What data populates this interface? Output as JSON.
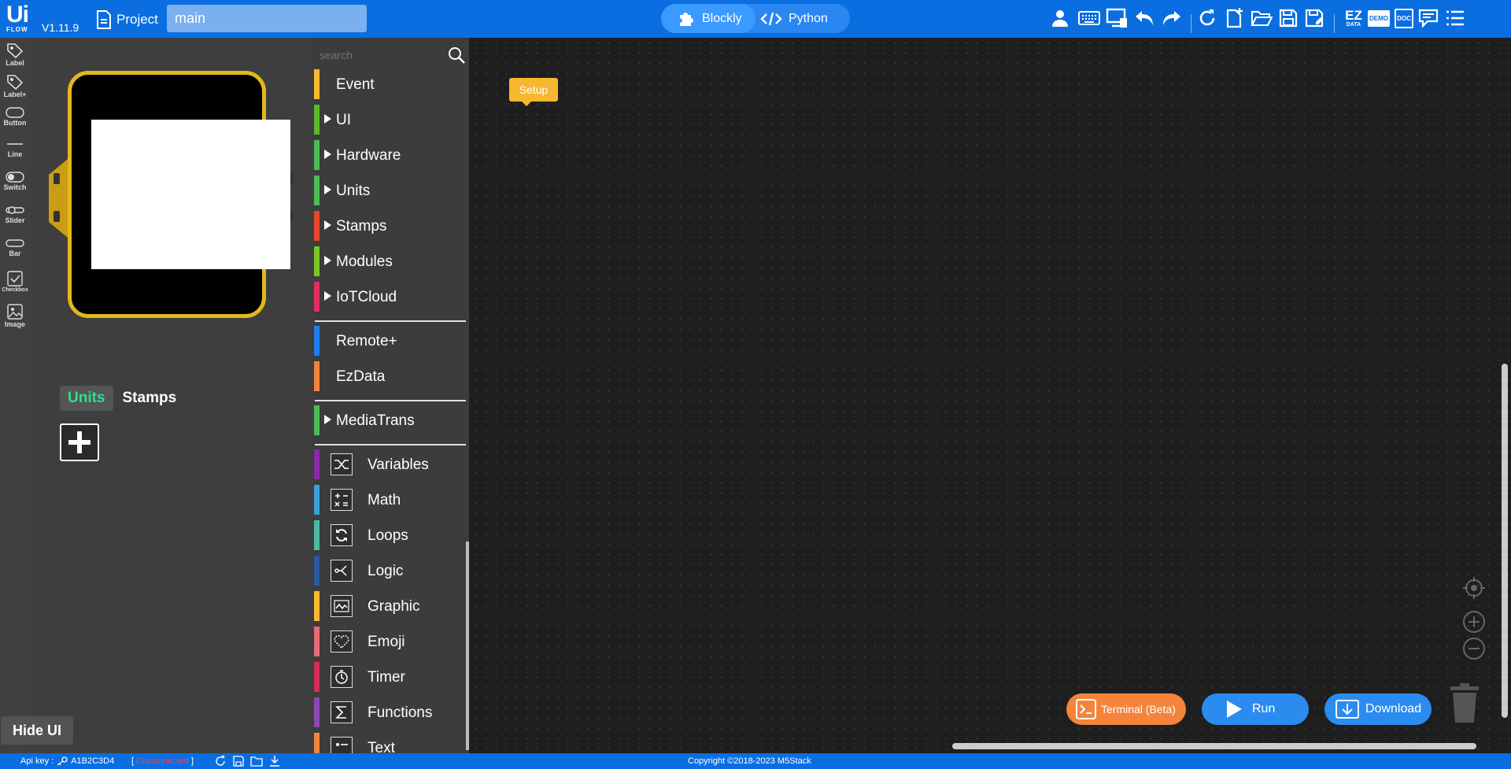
{
  "app": {
    "logo_main": "Ui",
    "logo_sub": "FLOW",
    "version": "V1.11.9",
    "project_label": "Project",
    "file_name": "main"
  },
  "mode": {
    "blockly": "Blockly",
    "python": "Python",
    "active": "Blockly"
  },
  "toolbar_icons": [
    "user-icon",
    "keyboard-icon",
    "device-icon",
    "undo-icon",
    "redo-icon",
    "refresh-icon",
    "new-file-icon",
    "open-folder-icon",
    "save-icon",
    "save-as-icon",
    "ezdata-icon",
    "demo-icon",
    "doc-icon",
    "chat-icon",
    "menu-icon"
  ],
  "toolbar_text": {
    "ez": "EZ",
    "ez_sub": "DATA",
    "demo": "DEMO",
    "doc": "DOC"
  },
  "widgets": [
    {
      "label": "Label"
    },
    {
      "label": "Label+"
    },
    {
      "label": "Button"
    },
    {
      "label": "Line"
    },
    {
      "label": "Switch"
    },
    {
      "label": "Slider"
    },
    {
      "label": "Bar"
    },
    {
      "label": "Checkbox"
    },
    {
      "label": "Image"
    }
  ],
  "device_tabs": {
    "units": "Units",
    "stamps": "Stamps",
    "active": "Units"
  },
  "hide_ui": "Hide UI",
  "toolbox": {
    "search_placeholder": "search",
    "categories": [
      {
        "label": "Event",
        "color": "#f7b730",
        "expandable": false
      },
      {
        "label": "UI",
        "color": "#5cb82e",
        "expandable": true
      },
      {
        "label": "Hardware",
        "color": "#4cbb56",
        "expandable": true
      },
      {
        "label": "Units",
        "color": "#4cbb56",
        "expandable": true
      },
      {
        "label": "Stamps",
        "color": "#e8452d",
        "expandable": true
      },
      {
        "label": "Modules",
        "color": "#7ac625",
        "expandable": true
      },
      {
        "label": "IoTCloud",
        "color": "#e32d5e",
        "expandable": true
      },
      {
        "label": "Remote+",
        "color": "#1e7ff0",
        "expandable": false
      },
      {
        "label": "EzData",
        "color": "#f4843c",
        "expandable": false
      },
      {
        "label": "MediaTrans",
        "color": "#4cbb56",
        "expandable": true
      },
      {
        "label": "Variables",
        "color": "#8a2aa8",
        "icon": "variables-icon"
      },
      {
        "label": "Math",
        "color": "#3aa0d8",
        "icon": "math-icon"
      },
      {
        "label": "Loops",
        "color": "#4cb8a0",
        "icon": "loops-icon"
      },
      {
        "label": "Logic",
        "color": "#2b5aa0",
        "icon": "logic-icon"
      },
      {
        "label": "Graphic",
        "color": "#f7b730",
        "icon": "graphic-icon"
      },
      {
        "label": "Emoji",
        "color": "#e86a78",
        "icon": "emoji-icon"
      },
      {
        "label": "Timer",
        "color": "#d62a5a",
        "icon": "timer-icon"
      },
      {
        "label": "Functions",
        "color": "#8a4ab0",
        "icon": "functions-icon"
      },
      {
        "label": "Text",
        "color": "#f4843c",
        "icon": "text-icon"
      }
    ]
  },
  "workspace": {
    "setup_block": "Setup",
    "terminal_button": "Terminal (Beta)",
    "run_button": "Run",
    "download_button": "Download"
  },
  "footer": {
    "api_key_label": "Api key :",
    "api_key": "A1B2C3D4",
    "status_open": "[",
    "status": "Disconnected",
    "status_close": "]",
    "copyright": "Copyright ©2018-2023 M5Stack"
  },
  "colors": {
    "topbar": "#0a6ee0",
    "panel": "#3e3e3e",
    "workspace": "#1e1e1e",
    "device_frame": "#e3b81d",
    "accent_green": "#2ee08a",
    "terminal": "#f4843c",
    "run": "#2b8cf0",
    "disconnected": "#ff3b5c"
  }
}
